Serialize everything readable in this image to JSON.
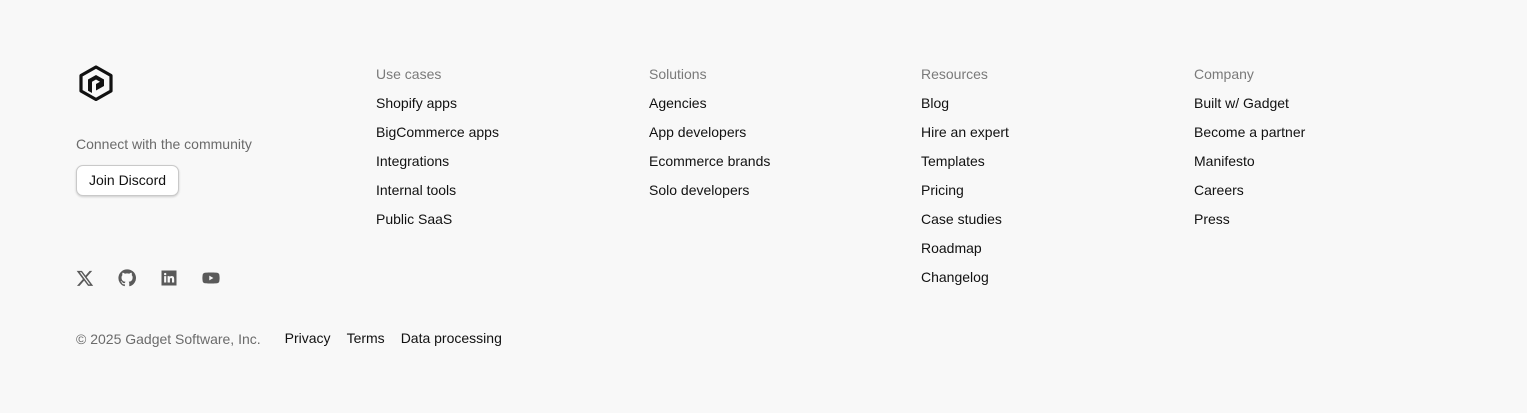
{
  "brand": {
    "community_label": "Connect with the community",
    "discord_button": "Join Discord"
  },
  "socials": [
    {
      "name": "x-icon"
    },
    {
      "name": "github-icon"
    },
    {
      "name": "linkedin-icon"
    },
    {
      "name": "youtube-icon"
    }
  ],
  "columns": [
    {
      "title": "Use cases",
      "links": [
        "Shopify apps",
        "BigCommerce apps",
        "Integrations",
        "Internal tools",
        "Public SaaS"
      ]
    },
    {
      "title": "Solutions",
      "links": [
        "Agencies",
        "App developers",
        "Ecommerce brands",
        "Solo developers"
      ]
    },
    {
      "title": "Resources",
      "links": [
        "Blog",
        "Hire an expert",
        "Templates",
        "Pricing",
        "Case studies",
        "Roadmap",
        "Changelog"
      ]
    },
    {
      "title": "Company",
      "links": [
        "Built w/ Gadget",
        "Become a partner",
        "Manifesto",
        "Careers",
        "Press"
      ]
    }
  ],
  "bottom": {
    "copyright": "© 2025 Gadget Software, Inc.",
    "links": [
      "Privacy",
      "Terms",
      "Data processing"
    ]
  },
  "colors": {
    "background": "#f8f8f8",
    "muted_text": "#6b6b6b",
    "link_text": "#111111"
  }
}
